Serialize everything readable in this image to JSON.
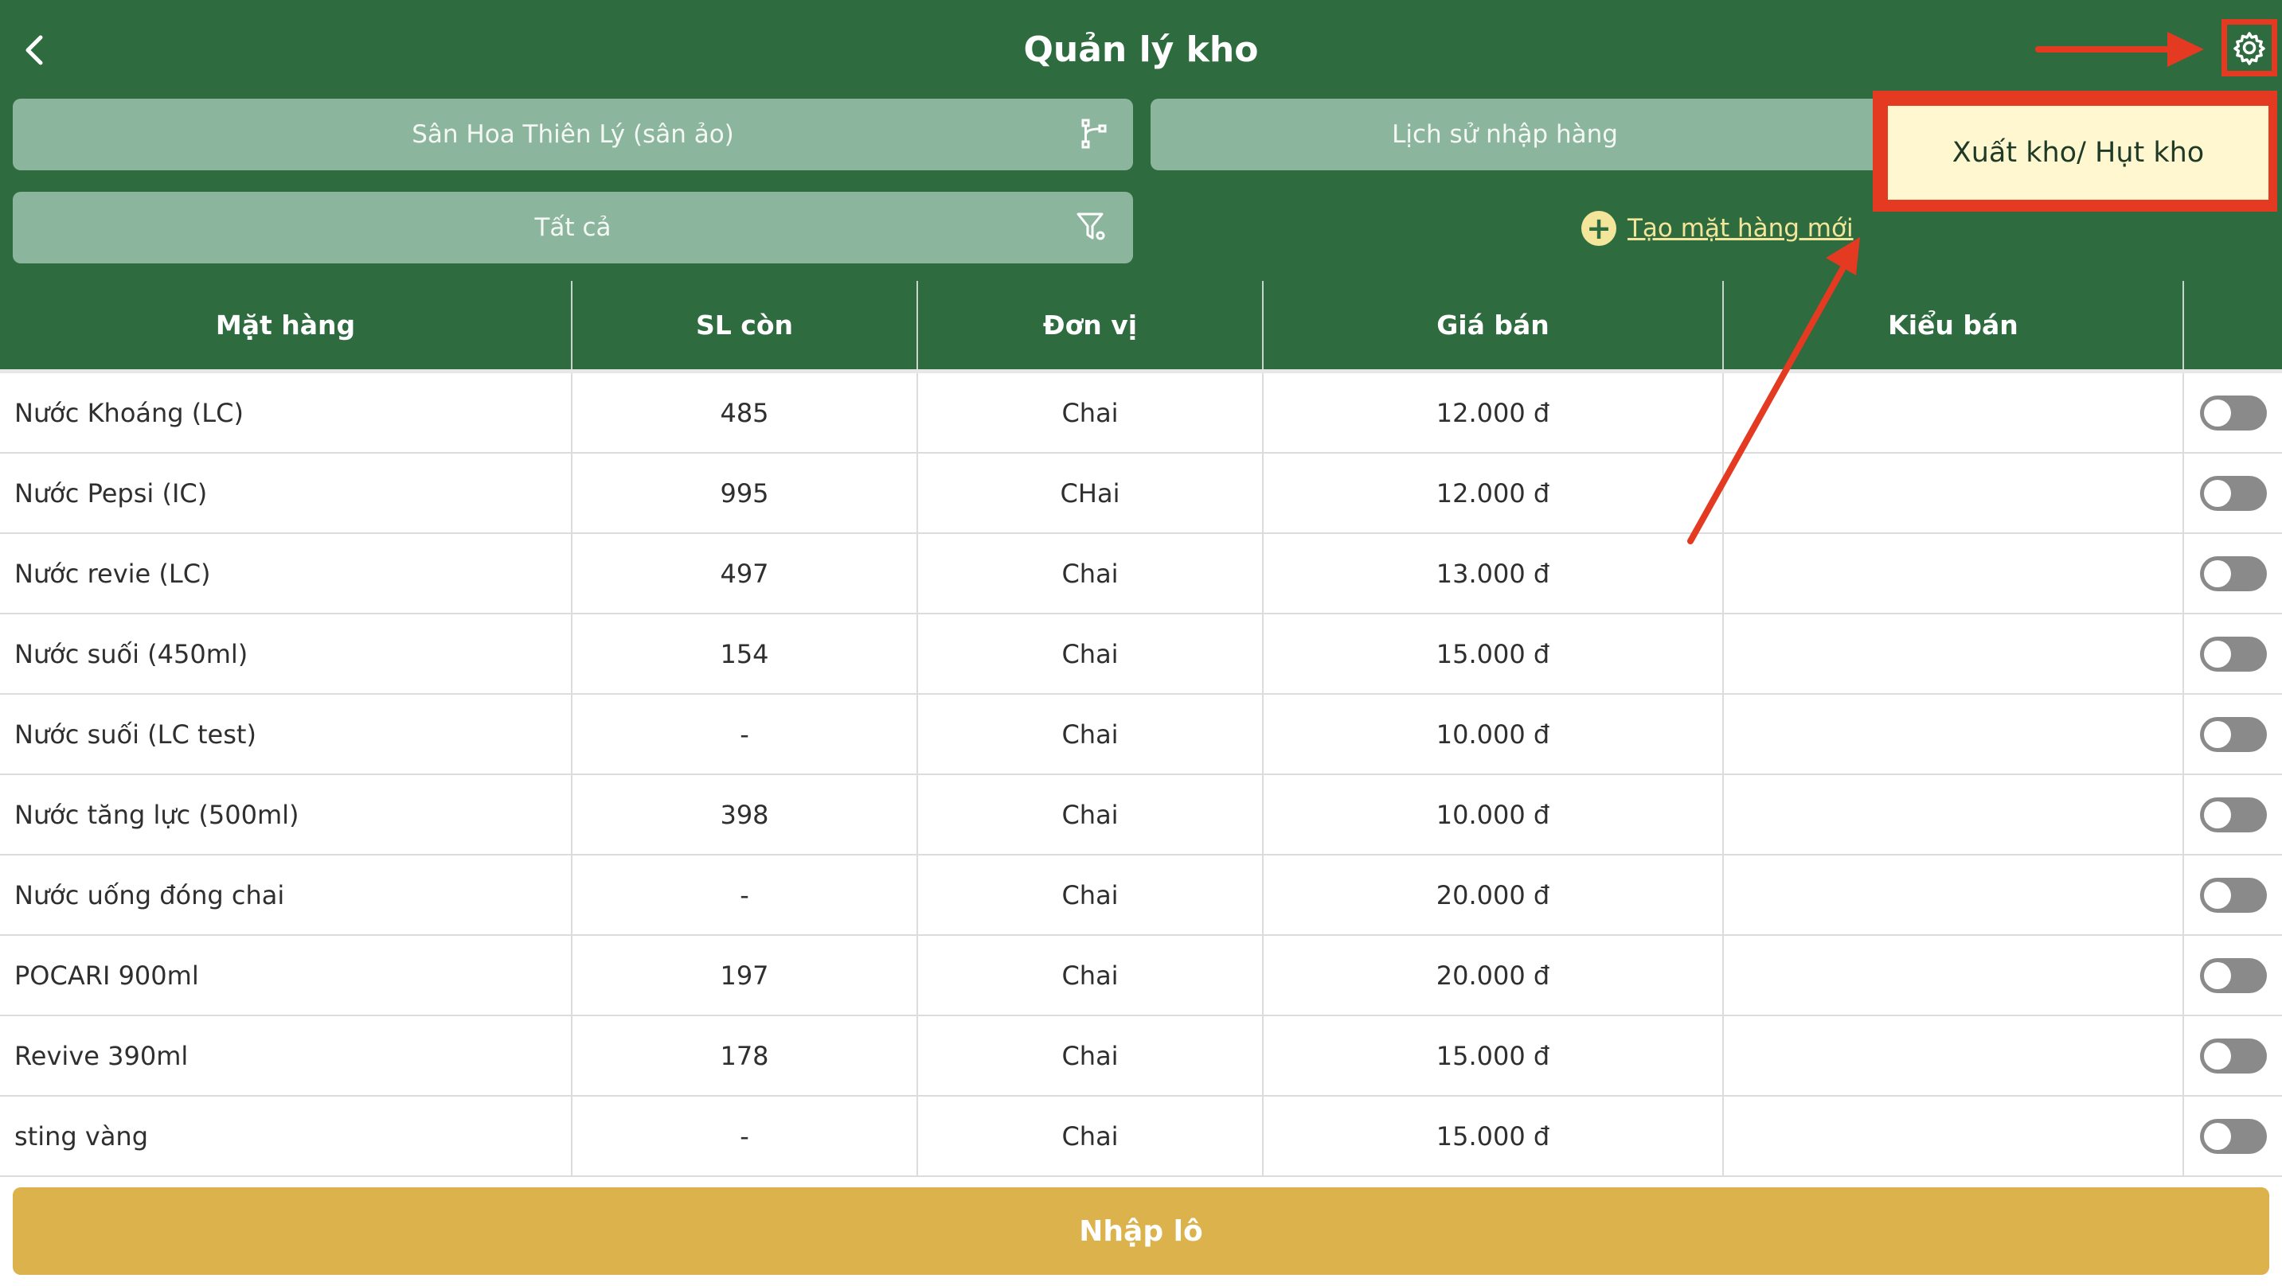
{
  "header": {
    "title": "Quản lý kho",
    "back_icon": "chevron-left-icon",
    "settings_icon": "gear-icon"
  },
  "filters": {
    "venue": "Sân Hoa Thiên Lý (sân ảo)",
    "category": "Tất cả",
    "import_history": "Lịch sử nhập hàng",
    "create_item": "Tạo mặt hàng mới"
  },
  "popover": {
    "label": "Xuất kho/ Hụt kho"
  },
  "table": {
    "columns": [
      "Mặt hàng",
      "SL còn",
      "Đơn vị",
      "Giá bán",
      "Kiểu bán",
      ""
    ],
    "rows": [
      {
        "name": "Nước Khoáng (LC)",
        "qty": "485",
        "unit": "Chai",
        "price": "12.000 đ",
        "type": "",
        "enabled": false
      },
      {
        "name": "Nước Pepsi (IC)",
        "qty": "995",
        "unit": "CHai",
        "price": "12.000 đ",
        "type": "",
        "enabled": false
      },
      {
        "name": "Nước revie (LC)",
        "qty": "497",
        "unit": "Chai",
        "price": "13.000 đ",
        "type": "",
        "enabled": false
      },
      {
        "name": "Nước suối (450ml)",
        "qty": "154",
        "unit": "Chai",
        "price": "15.000 đ",
        "type": "",
        "enabled": false
      },
      {
        "name": "Nước suối (LC test)",
        "qty": "-",
        "unit": "Chai",
        "price": "10.000 đ",
        "type": "",
        "enabled": false
      },
      {
        "name": "Nước tăng lực (500ml)",
        "qty": "398",
        "unit": "Chai",
        "price": "10.000 đ",
        "type": "",
        "enabled": false
      },
      {
        "name": "Nước uống đóng chai",
        "qty": "-",
        "unit": "Chai",
        "price": "20.000 đ",
        "type": "",
        "enabled": false
      },
      {
        "name": "POCARI 900ml",
        "qty": "197",
        "unit": "Chai",
        "price": "20.000 đ",
        "type": "",
        "enabled": false
      },
      {
        "name": "Revive 390ml",
        "qty": "178",
        "unit": "Chai",
        "price": "15.000 đ",
        "type": "",
        "enabled": false
      },
      {
        "name": "sting vàng",
        "qty": "-",
        "unit": "Chai",
        "price": "15.000 đ",
        "type": "",
        "enabled": false
      }
    ]
  },
  "footer": {
    "button_label": "Nhập lô"
  },
  "colors": {
    "header_bg": "#2e6b3e",
    "pill_bg": "#8cb59d",
    "accent_yellow": "#f3e59a",
    "annotation_red": "#e53a22",
    "footer_bg": "#dbb24b"
  }
}
